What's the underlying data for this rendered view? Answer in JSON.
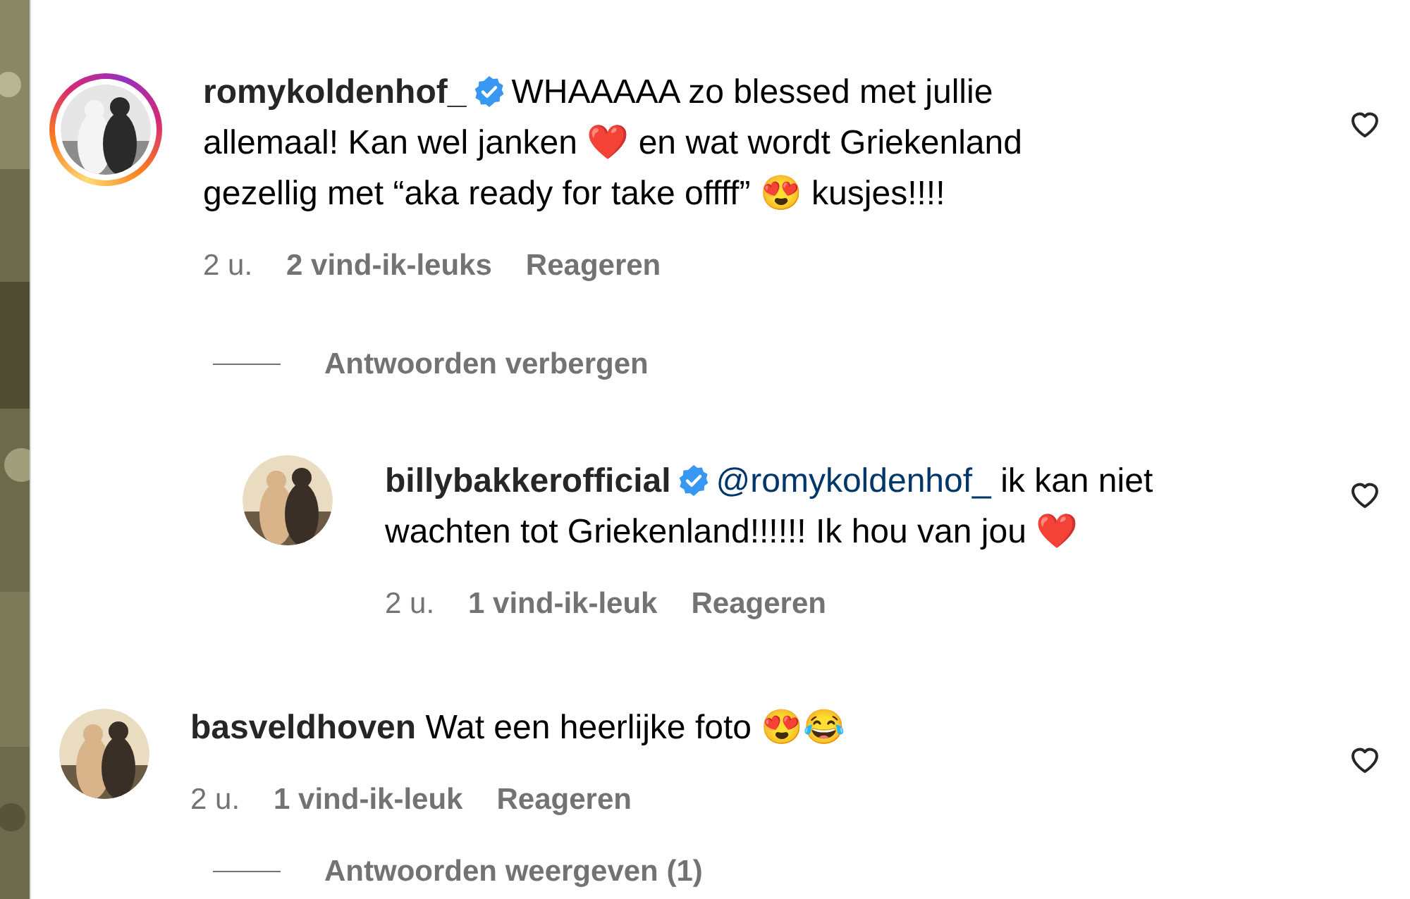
{
  "comments": [
    {
      "username": "romykoldenhof_",
      "verified": true,
      "story_ring": true,
      "text": "WHAAAAA zo blessed met jullie allemaal! Kan wel janken ❤️ en wat wordt Griekenland gezellig met “aka ready for take offff” 😍 kusjes!!!!",
      "time": "2 u.",
      "likes": "2 vind-ik-leuks",
      "reply_label": "Reageren",
      "replies_toggle": "Antwoorden verbergen",
      "replies_open": true,
      "replies": [
        {
          "username": "billybakkerofficial",
          "verified": true,
          "story_ring": false,
          "mention": "@romykoldenhof_",
          "text": "ik kan niet wachten tot Griekenland!!!!!! Ik hou van jou ❤️",
          "time": "2 u.",
          "likes": "1 vind-ik-leuk",
          "reply_label": "Reageren"
        }
      ]
    },
    {
      "username": "basveldhoven",
      "verified": false,
      "story_ring": false,
      "text": "Wat een heerlijke foto 😍😂",
      "time": "2 u.",
      "likes": "1 vind-ik-leuk",
      "reply_label": "Reageren",
      "replies_toggle": "Antwoorden weergeven (1)",
      "replies_open": false
    }
  ]
}
